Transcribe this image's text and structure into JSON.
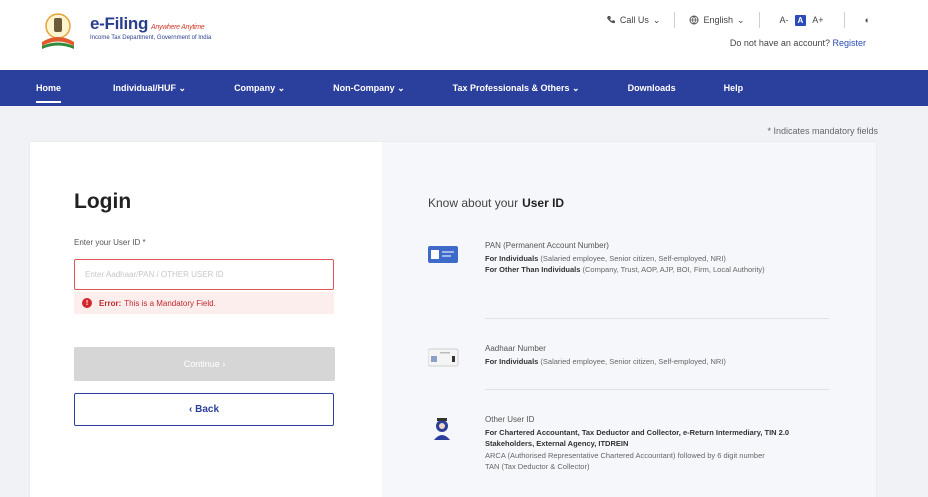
{
  "header": {
    "logo_title": "e-Filing",
    "logo_tagline": "Anywhere Anytime",
    "logo_subtitle": "Income Tax Department, Government of India",
    "call_us": "Call Us",
    "language": "English",
    "font_small": "A-",
    "font_normal": "A",
    "font_large": "A+",
    "contrast": "◐",
    "no_account": "Do not have an account?",
    "register": "Register"
  },
  "nav": {
    "items": [
      {
        "label": "Home"
      },
      {
        "label": "Individual/HUF ⌄"
      },
      {
        "label": "Company ⌄"
      },
      {
        "label": "Non-Company ⌄"
      },
      {
        "label": "Tax Professionals & Others ⌄"
      },
      {
        "label": "Downloads"
      },
      {
        "label": "Help"
      }
    ]
  },
  "mandatory_note": "* Indicates mandatory fields",
  "login": {
    "title": "Login",
    "field_label": "Enter your User ID *",
    "placeholder": "Enter Aadhaar/PAN / OTHER USER ID",
    "error_label": "Error:",
    "error_text": "This is a Mandatory Field.",
    "continue": "Continue ›",
    "back": "‹ Back"
  },
  "know": {
    "prefix": "Know about your",
    "bold": "User ID",
    "items": [
      {
        "title": "PAN (Permanent Account Number)",
        "l1_bold": "For Individuals",
        "l1_rest": " (Salaried employee, Senior citizen, Self-employed, NRI)",
        "l2_bold": "For Other Than Individuals",
        "l2_rest": " (Company, Trust, AOP, AJP, BOI, Firm, Local Authority)"
      },
      {
        "title": "Aadhaar Number",
        "l1_bold": "For Individuals",
        "l1_rest": " (Salaried employee, Senior citizen, Self-employed, NRI)"
      },
      {
        "title": "Other User ID",
        "l1_bold": "For Chartered Accountant, Tax Deductor and Collector, e-Return Intermediary, TIN 2.0 Stakeholders, External Agency, ITDREIN",
        "l2": "ARCA (Authorised Representative Chartered Accountant) followed by 6 digit number",
        "l3": "TAN (Tax Deductor & Collector)"
      }
    ]
  },
  "colors": {
    "nav_bg": "#2b3f9c",
    "accent": "#2a4bb8",
    "error": "#d2282d"
  }
}
